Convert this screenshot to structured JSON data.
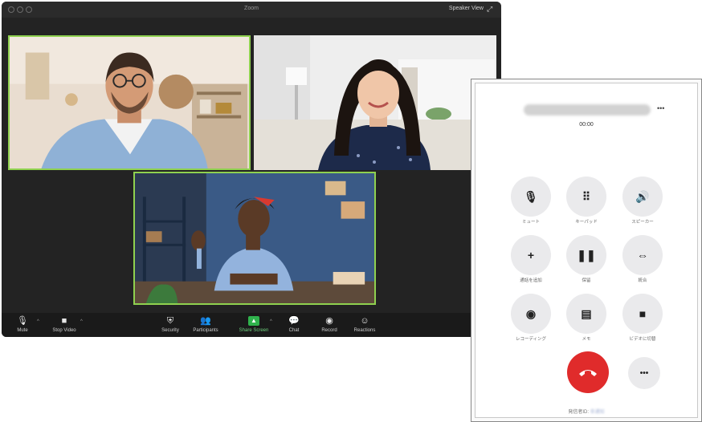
{
  "zoom": {
    "window_title": "Zoom",
    "speaker_view_label": "Speaker View",
    "toolbar": {
      "mute": "Mute",
      "stop_video": "Stop Video",
      "security": "Security",
      "participants": "Participants",
      "share_screen": "Share Screen",
      "chat": "Chat",
      "record": "Record",
      "reactions": "Reactions"
    },
    "accent_color": "#8fd14f",
    "share_color": "#2fb24c"
  },
  "phone": {
    "call_time": "00:00",
    "buttons": {
      "mute": "ミュート",
      "keypad": "キーパッド",
      "speaker": "スピーカー",
      "add_call": "通話を追加",
      "hold": "保留",
      "merge": "統合",
      "record": "レコーディング",
      "notes": "メモ",
      "video": "ビデオに切替"
    },
    "footer_prefix": "発信者ID:",
    "footer_value": "非通知",
    "hangup_color": "#e02b2b"
  }
}
